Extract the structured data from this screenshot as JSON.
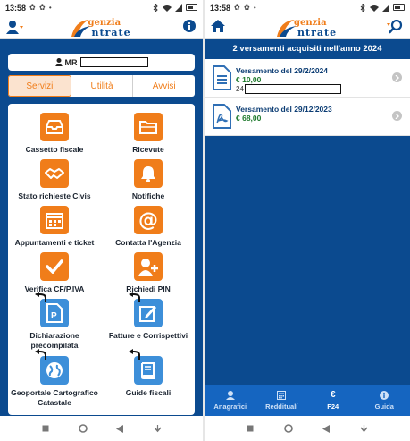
{
  "status_bar": {
    "time": "13:58",
    "left_icons": "✿ ✿ •"
  },
  "logo": {
    "line1": "genzia",
    "line2": "ntrate"
  },
  "left": {
    "user_prefix": "MR",
    "tabs": [
      {
        "label": "Servizi",
        "active": true
      },
      {
        "label": "Utilità",
        "active": false
      },
      {
        "label": "Avvisi",
        "active": false
      }
    ],
    "tiles": [
      {
        "label": "Cassetto fiscale",
        "icon": "inbox-icon",
        "color": "orange"
      },
      {
        "label": "Ricevute",
        "icon": "folder-icon",
        "color": "orange"
      },
      {
        "label": "Stato richieste Civis",
        "icon": "handshake-icon",
        "color": "orange"
      },
      {
        "label": "Notifiche",
        "icon": "bell-icon",
        "color": "orange"
      },
      {
        "label": "Appuntamenti e ticket",
        "icon": "calendar-icon",
        "color": "orange"
      },
      {
        "label": "Contatta l'Agenzia",
        "icon": "at-icon",
        "color": "orange"
      },
      {
        "label": "Verifica CF/P.IVA",
        "icon": "check-icon",
        "color": "orange"
      },
      {
        "label": "Richiedi PIN",
        "icon": "user-add-icon",
        "color": "orange"
      },
      {
        "label": "Dichiarazione precompilata",
        "icon": "document-p-icon",
        "color": "blue"
      },
      {
        "label": "Fatture e Corrispettivi",
        "icon": "edit-icon",
        "color": "blue"
      },
      {
        "label": "Geoportale Cartografico Catastale",
        "icon": "globe-icon",
        "color": "blue"
      },
      {
        "label": "Guide fiscali",
        "icon": "book-icon",
        "color": "blue"
      }
    ]
  },
  "right": {
    "title": "2 versamenti acquisiti nell'anno 2024",
    "items": [
      {
        "title": "Versamento del 29/2/2024",
        "amount": "€ 10,00",
        "ref_prefix": "24",
        "icon": "document-icon"
      },
      {
        "title": "Versamento del 29/12/2023",
        "amount": "€ 68,00",
        "icon": "pdf-icon"
      }
    ],
    "bottom_tabs": [
      {
        "label": "Anagrafici",
        "icon": "person-icon",
        "active": false
      },
      {
        "label": "Redditualí",
        "icon": "calculator-icon",
        "active": false
      },
      {
        "label": "F24",
        "icon": "euro-icon",
        "active": true
      },
      {
        "label": "Guida",
        "icon": "info-icon",
        "active": false
      }
    ]
  },
  "colors": {
    "primary": "#0b4a8f",
    "accent": "#f07d1a",
    "tile_blue": "#3d8fd9",
    "amount_green": "#1f7a2d"
  }
}
